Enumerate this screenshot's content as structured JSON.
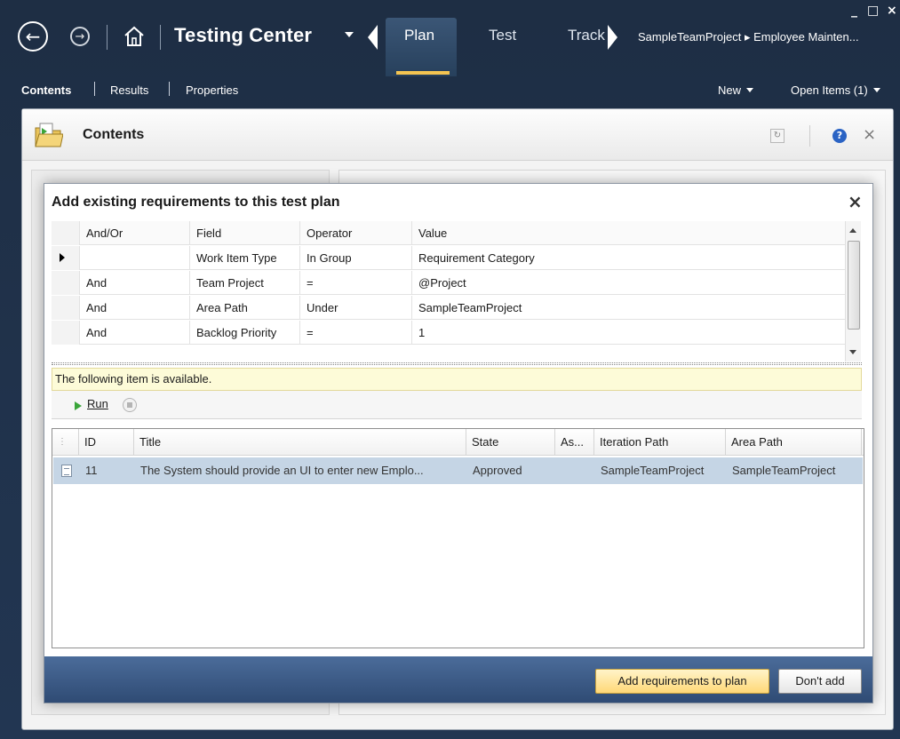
{
  "window": {
    "minimize": "_",
    "maximize": "□",
    "close": "×"
  },
  "topnav": {
    "back_icon": "back-arrow-icon",
    "forward_icon": "forward-arrow-icon",
    "home_icon": "home-icon",
    "app_name": "Testing Center",
    "tabs": [
      {
        "label": "Plan",
        "active": true
      },
      {
        "label": "Test",
        "active": false
      },
      {
        "label": "Track",
        "active": false
      }
    ],
    "breadcrumb": "SampleTeamProject ▸ Employee Mainten..."
  },
  "subnav": {
    "items": [
      "Contents",
      "Results",
      "Properties"
    ],
    "new_label": "New",
    "open_items_label": "Open Items (1)"
  },
  "panel": {
    "title": "Contents",
    "help": "?",
    "close": "×"
  },
  "dialog": {
    "title": "Add existing requirements to this test plan",
    "close": "×",
    "query": {
      "headers": [
        "",
        "And/Or",
        "Field",
        "Operator",
        "Value"
      ],
      "rows": [
        {
          "andor": "",
          "field": "Work Item Type",
          "operator": "In Group",
          "value": "Requirement Category",
          "current": true
        },
        {
          "andor": "And",
          "field": "Team Project",
          "operator": "=",
          "value": "@Project",
          "current": false
        },
        {
          "andor": "And",
          "field": "Area Path",
          "operator": "Under",
          "value": "SampleTeamProject",
          "current": false
        },
        {
          "andor": "And",
          "field": "Backlog Priority",
          "operator": "=",
          "value": "1",
          "current": false
        }
      ]
    },
    "info": "The following item is available.",
    "run_label": "Run",
    "results": {
      "headers": [
        "ID",
        "Title",
        "State",
        "As...",
        "Iteration Path",
        "Area Path"
      ],
      "rows": [
        {
          "id": "11",
          "title": "The System should provide an UI to enter new Emplo...",
          "state": "Approved",
          "assigned": "",
          "iteration": "SampleTeamProject",
          "area": "SampleTeamProject"
        }
      ]
    },
    "add_button": "Add requirements to plan",
    "dont_add_button": "Don't add"
  },
  "colors": {
    "header_bg": "#1e2e44",
    "active_tab_underline": "#f4c451",
    "selected_row": "#c5d5e5",
    "info_bar": "#fdfbd8",
    "footer_bg": "#2f4b74",
    "primary_button": "#ffd877"
  }
}
